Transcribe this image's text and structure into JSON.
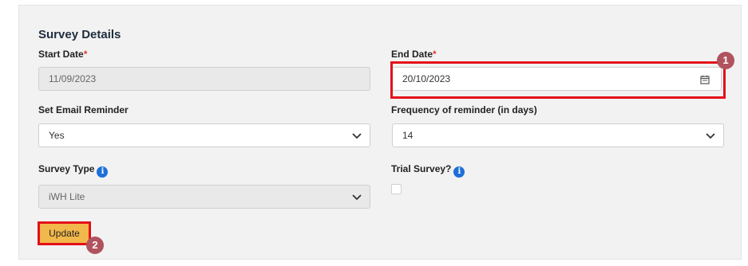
{
  "section": {
    "title": "Survey Details"
  },
  "fields": {
    "start_date": {
      "label": "Start Date",
      "required_mark": "*",
      "value": "11/09/2023"
    },
    "end_date": {
      "label": "End Date",
      "required_mark": "*",
      "value": "20/10/2023"
    },
    "email_reminder": {
      "label": "Set Email Reminder",
      "value": "Yes"
    },
    "frequency": {
      "label": "Frequency of reminder (in days)",
      "value": "14"
    },
    "survey_type": {
      "label": "Survey Type",
      "value": "iWH Lite"
    },
    "trial_survey": {
      "label": "Trial Survey?",
      "checked": false
    }
  },
  "buttons": {
    "update": "Update"
  },
  "callouts": {
    "first": "1",
    "second": "2"
  },
  "icons": {
    "info": "info-icon",
    "calendar": "calendar-icon",
    "dropdown": "chevron-down-icon"
  },
  "colors": {
    "highlight": "#e3101a",
    "update_button": "#f2b84b",
    "callout": "#b0535e",
    "info": "#1e6fd9"
  }
}
